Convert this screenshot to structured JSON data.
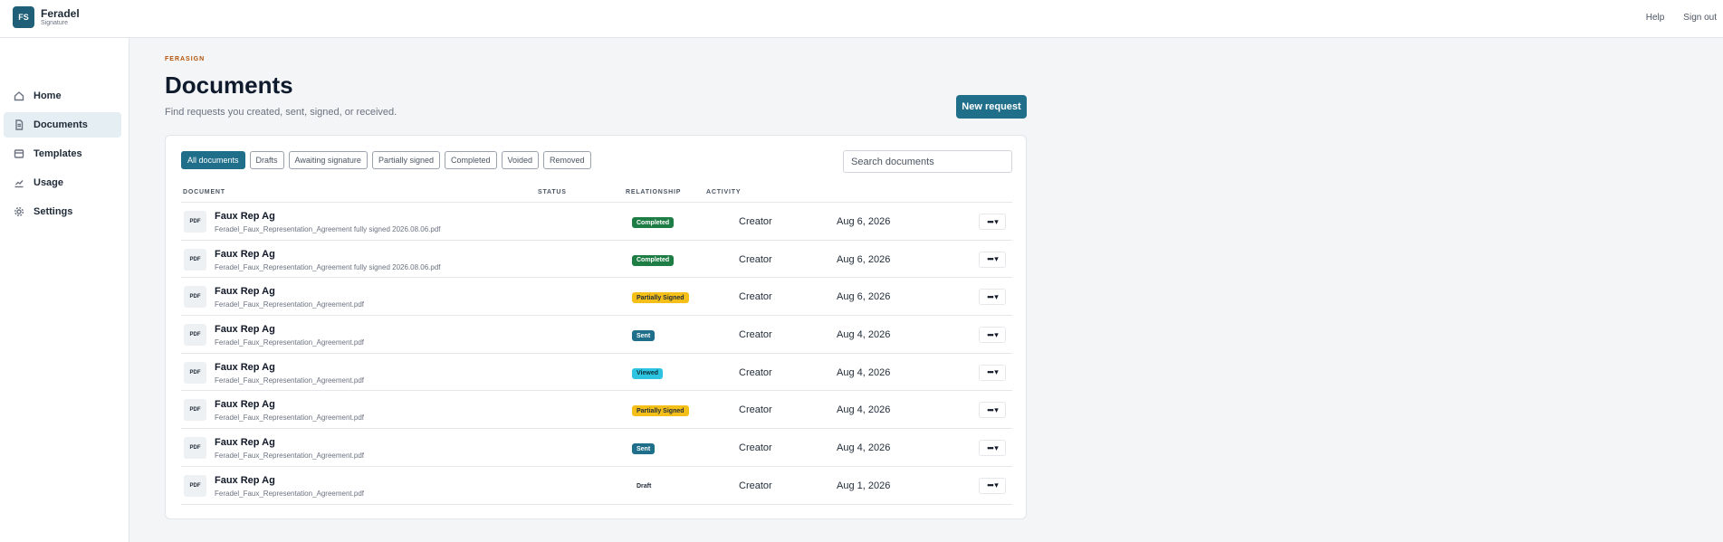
{
  "brand": {
    "logo": "FS",
    "name": "Feradel",
    "sub": "Signature"
  },
  "top_links": {
    "help": "Help",
    "signout": "Sign out"
  },
  "nav": [
    {
      "label": "Home",
      "icon": "home-icon"
    },
    {
      "label": "Documents",
      "icon": "document-icon",
      "active": true
    },
    {
      "label": "Templates",
      "icon": "template-icon"
    },
    {
      "label": "Usage",
      "icon": "chart-icon"
    },
    {
      "label": "Settings",
      "icon": "gear-icon"
    }
  ],
  "page": {
    "eyebrow": "FERASIGN",
    "title": "Documents",
    "subtitle": "Find requests you created, sent, signed, or received.",
    "new_request": "New request"
  },
  "filters": [
    "All documents",
    "Drafts",
    "Awaiting signature",
    "Partially signed",
    "Completed",
    "Voided",
    "Removed"
  ],
  "search": {
    "placeholder": "Search documents"
  },
  "columns": {
    "document": "DOCUMENT",
    "status": "STATUS",
    "relationship": "RELATIONSHIP",
    "activity": "ACTIVITY"
  },
  "pdf_label": "PDF",
  "more_label": "••• ▾",
  "rows": [
    {
      "title": "Faux Rep Ag",
      "file": "Feradel_Faux_Representation_Agreement fully signed 2026.08.06.pdf",
      "status": "Completed",
      "relationship": "Creator",
      "activity": "Aug 6, 2026"
    },
    {
      "title": "Faux Rep Ag",
      "file": "Feradel_Faux_Representation_Agreement fully signed 2026.08.06.pdf",
      "status": "Completed",
      "relationship": "Creator",
      "activity": "Aug 6, 2026"
    },
    {
      "title": "Faux Rep Ag",
      "file": "Feradel_Faux_Representation_Agreement.pdf",
      "status": "Partially Signed",
      "relationship": "Creator",
      "activity": "Aug 6, 2026"
    },
    {
      "title": "Faux Rep Ag",
      "file": "Feradel_Faux_Representation_Agreement.pdf",
      "status": "Sent",
      "relationship": "Creator",
      "activity": "Aug 4, 2026"
    },
    {
      "title": "Faux Rep Ag",
      "file": "Feradel_Faux_Representation_Agreement.pdf",
      "status": "Viewed",
      "relationship": "Creator",
      "activity": "Aug 4, 2026"
    },
    {
      "title": "Faux Rep Ag",
      "file": "Feradel_Faux_Representation_Agreement.pdf",
      "status": "Partially Signed",
      "relationship": "Creator",
      "activity": "Aug 4, 2026"
    },
    {
      "title": "Faux Rep Ag",
      "file": "Feradel_Faux_Representation_Agreement.pdf",
      "status": "Sent",
      "relationship": "Creator",
      "activity": "Aug 4, 2026"
    },
    {
      "title": "Faux Rep Ag",
      "file": "Feradel_Faux_Representation_Agreement.pdf",
      "status": "Draft",
      "relationship": "Creator",
      "activity": "Aug 1, 2026"
    }
  ]
}
